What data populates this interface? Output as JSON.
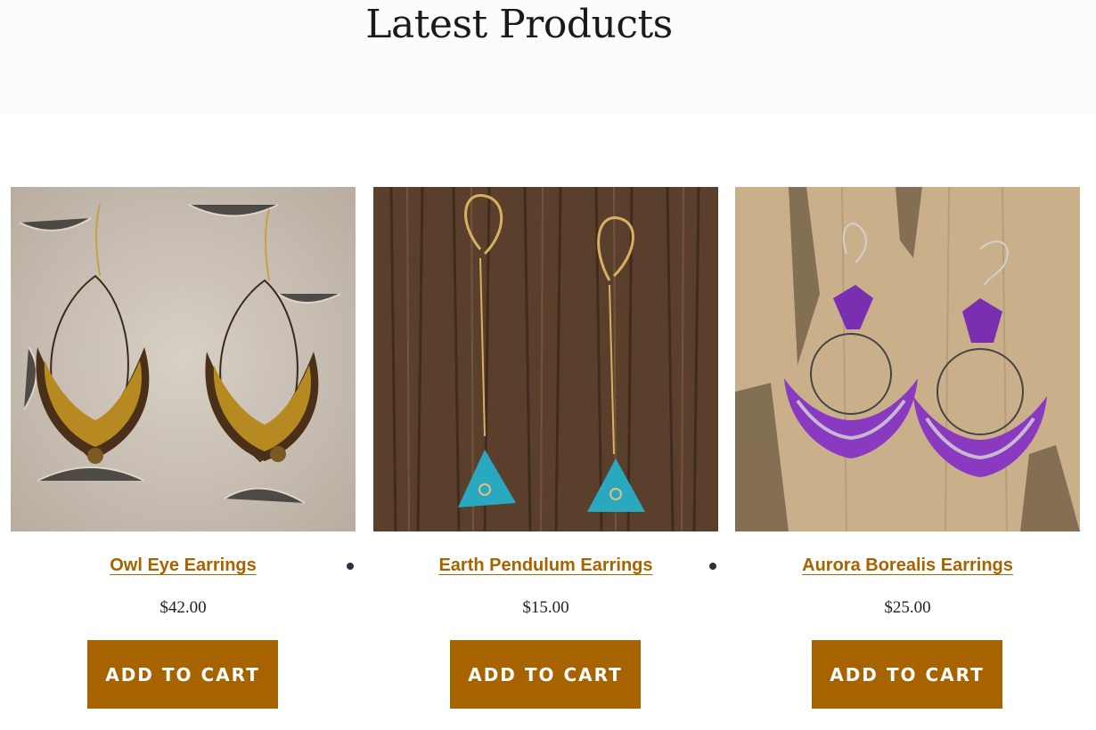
{
  "section": {
    "title": "Latest Products"
  },
  "products": [
    {
      "name": "Owl Eye Earrings",
      "price": "$42.00",
      "button": "ADD TO CART",
      "image": "owl-eye-earrings-photo"
    },
    {
      "name": "Earth Pendulum Earrings",
      "price": "$15.00",
      "button": "ADD TO CART",
      "image": "earth-pendulum-earrings-photo"
    },
    {
      "name": "Aurora Borealis Earrings",
      "price": "$25.00",
      "button": "ADD TO CART",
      "image": "aurora-borealis-earrings-photo"
    }
  ],
  "colors": {
    "accent": "#a66300",
    "title": "#1a1a1a",
    "price": "#222222",
    "bullet": "#2a3342"
  }
}
